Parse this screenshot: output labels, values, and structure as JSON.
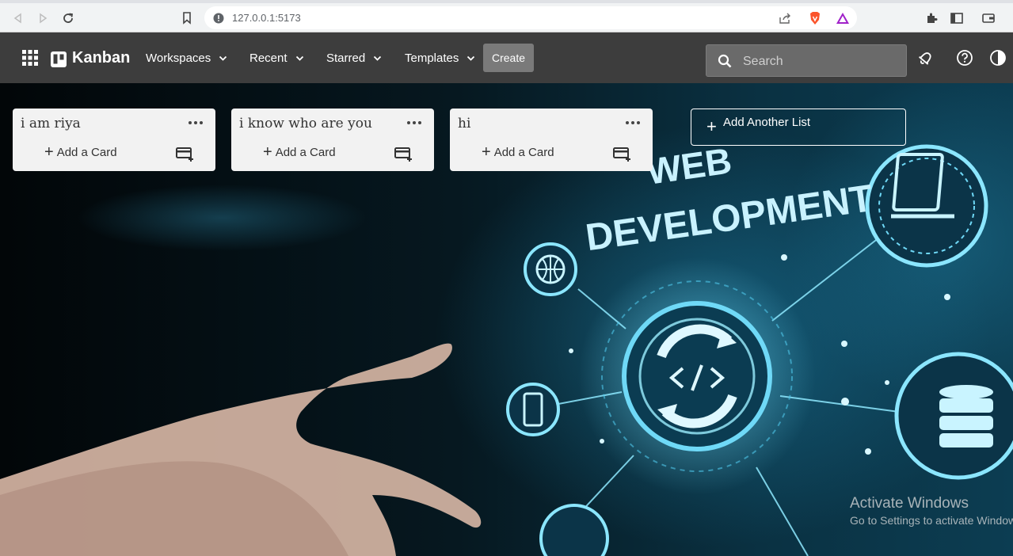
{
  "browser": {
    "url": "127.0.0.1:5173"
  },
  "nav": {
    "logo": "Kanban",
    "menus": [
      {
        "label": "Workspaces"
      },
      {
        "label": "Recent"
      },
      {
        "label": "Starred"
      },
      {
        "label": "Templates"
      }
    ],
    "create_label": "Create",
    "search_placeholder": "Search"
  },
  "board": {
    "lists": [
      {
        "title": "i am riya",
        "add_card_label": "Add a Card"
      },
      {
        "title": "i know who are you",
        "add_card_label": "Add a Card"
      },
      {
        "title": "hi",
        "add_card_label": "Add a Card"
      }
    ],
    "add_list_label": "Add Another List",
    "background_text": [
      "WEB",
      "DEVELOPMENT"
    ]
  },
  "watermark": {
    "title": "Activate Windows",
    "subtitle": "Go to Settings to activate Windows."
  },
  "colors": {
    "nav_bg": "#3d3d3d",
    "list_bg": "#f2f2f2",
    "create_bg": "#7a7a7a",
    "accent_glow": "#5fd3f5"
  }
}
